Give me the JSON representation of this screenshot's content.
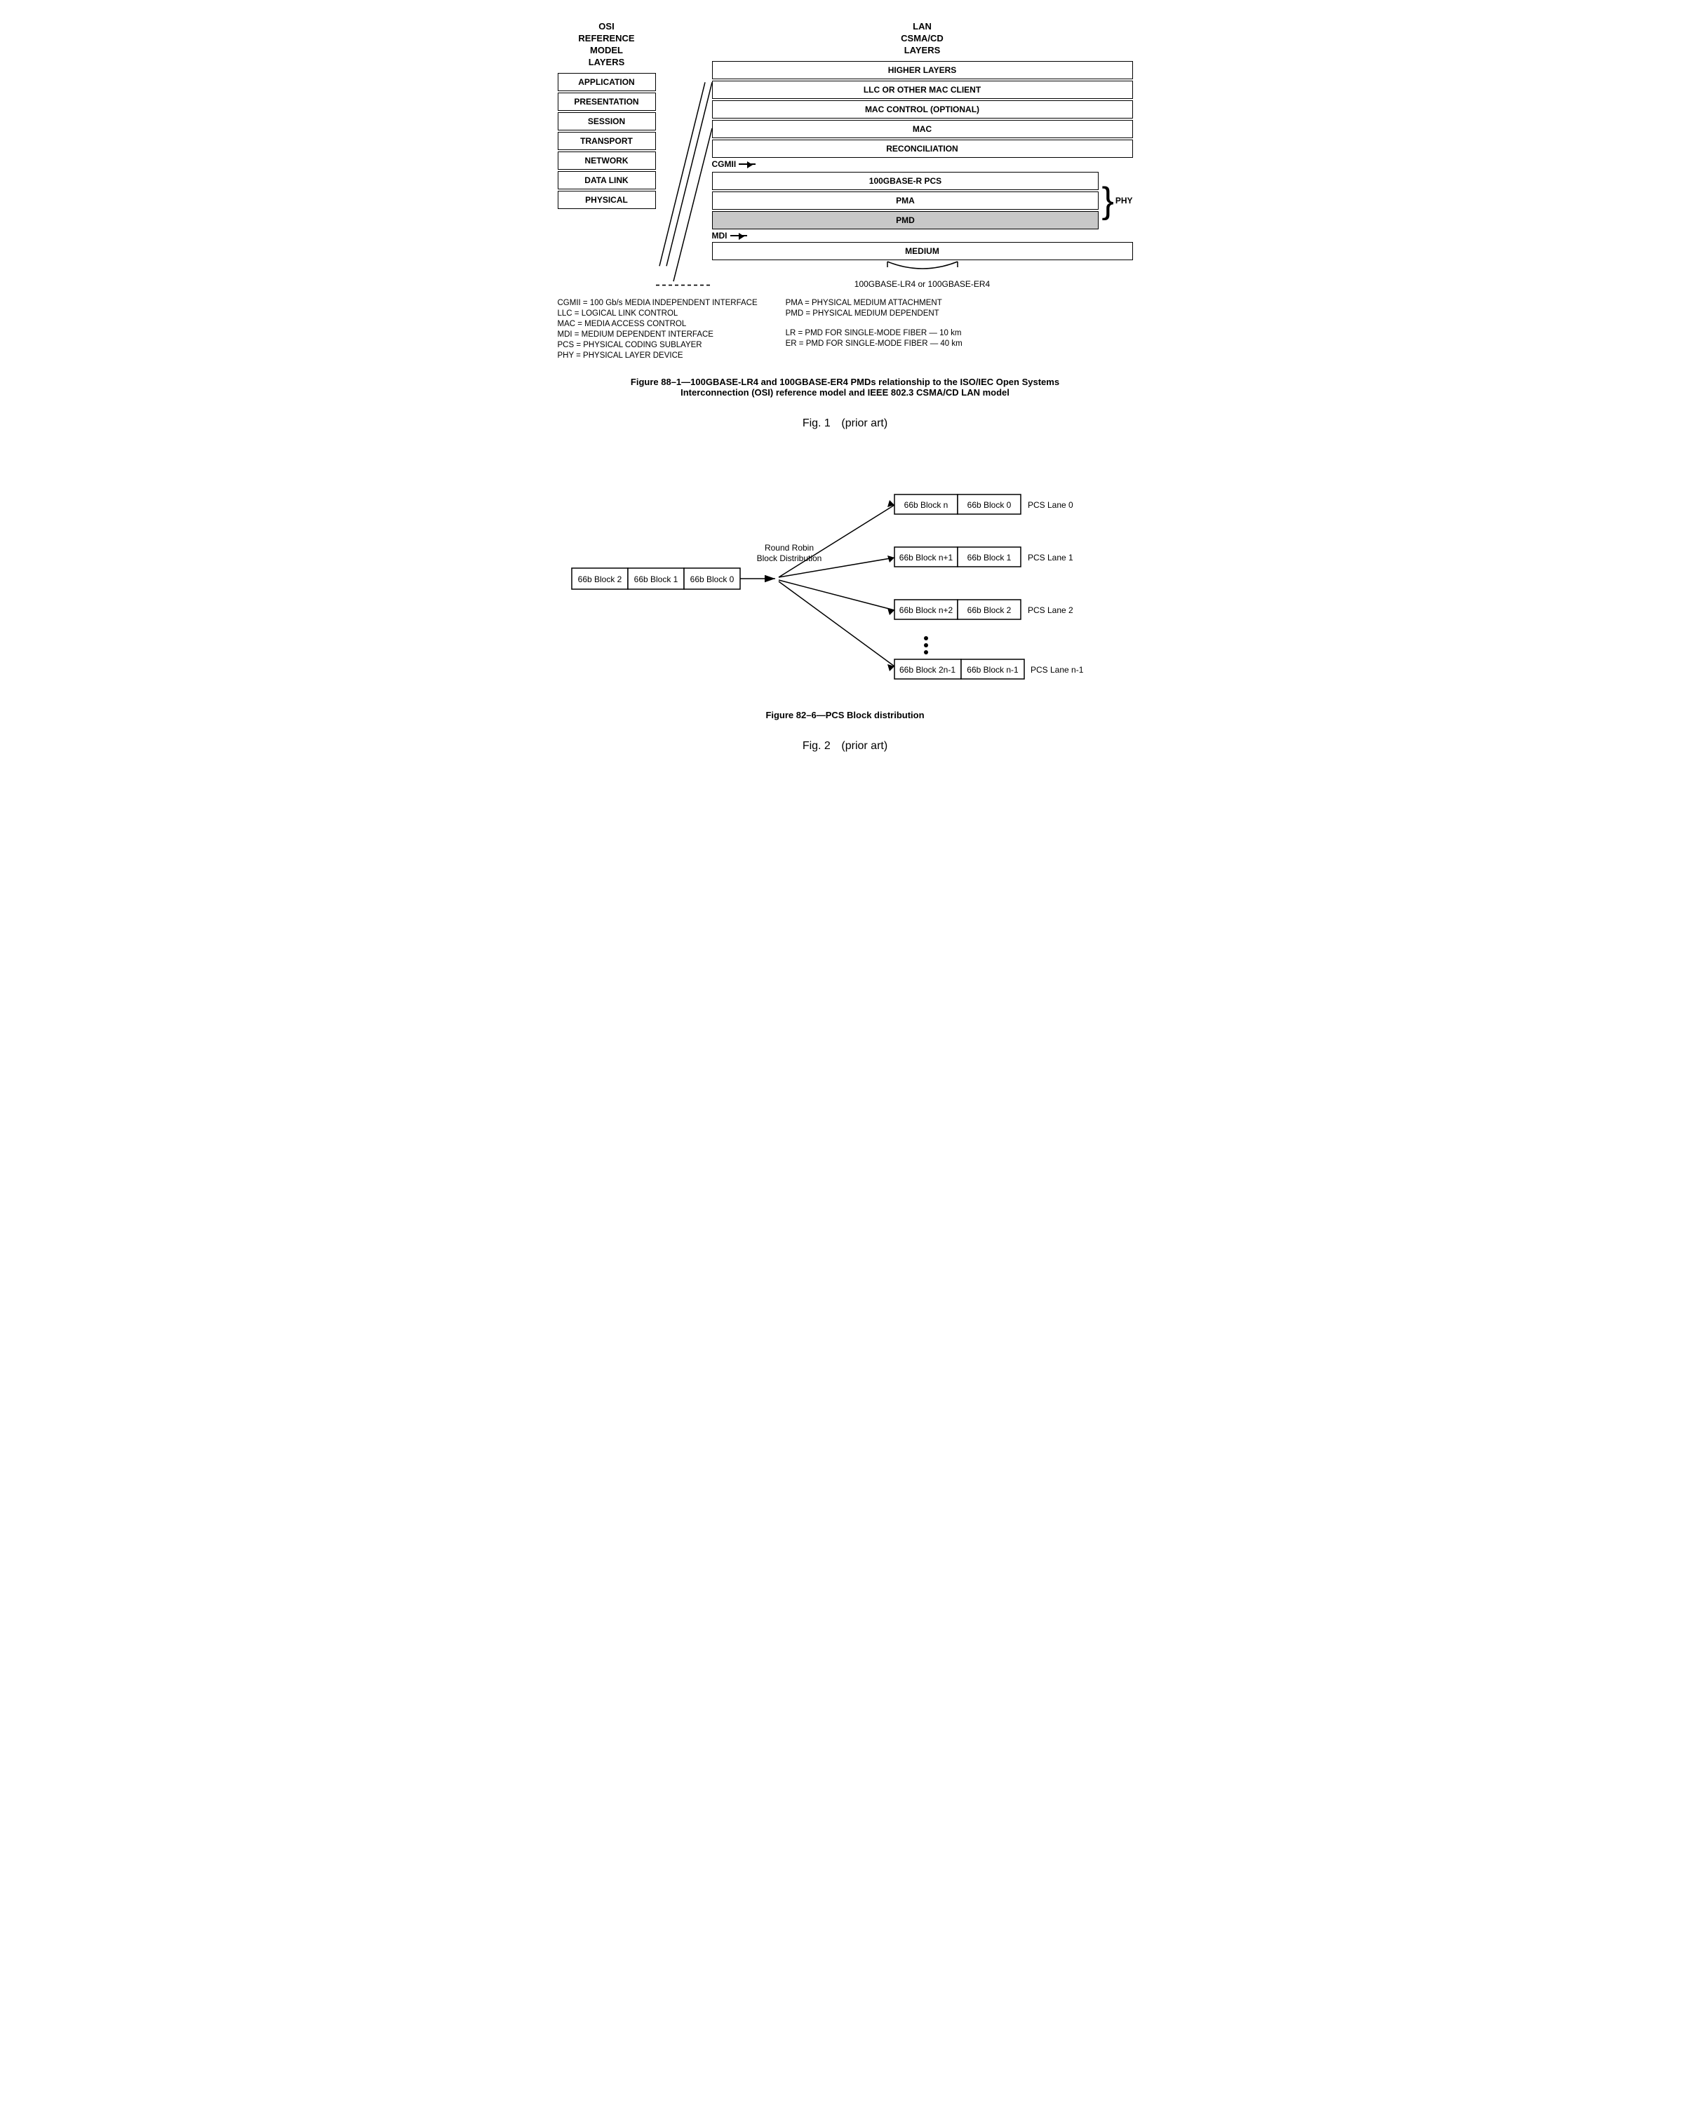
{
  "fig1": {
    "osi": {
      "header": "OSI\nREFERENCE\nMODEL\nLAYERS",
      "layers": [
        "APPLICATION",
        "PRESENTATION",
        "SESSION",
        "TRANSPORT",
        "NETWORK",
        "DATA LINK",
        "PHYSICAL"
      ]
    },
    "lan": {
      "header": "LAN\nCSMA/CD\nLAYERS",
      "layers": [
        {
          "label": "HIGHER LAYERS",
          "shaded": false
        },
        {
          "label": "LLC OR OTHER MAC CLIENT",
          "shaded": false
        },
        {
          "label": "MAC CONTROL (OPTIONAL)",
          "shaded": false
        },
        {
          "label": "MAC",
          "shaded": false
        },
        {
          "label": "RECONCILIATION",
          "shaded": false
        }
      ],
      "cgmii": "CGMII",
      "pcs": "100GBASE-R PCS",
      "pma": "PMA",
      "pmd": "PMD",
      "phy_label": "PHY",
      "mdi": "MDI",
      "medium": "MEDIUM",
      "medium_sub": "100GBASE-LR4 or 100GBASE-ER4"
    },
    "abbrev": {
      "left": [
        "CGMII = 100 Gb/s MEDIA INDEPENDENT INTERFACE",
        "LLC = LOGICAL LINK CONTROL",
        "MAC = MEDIA ACCESS CONTROL",
        "MDI = MEDIUM DEPENDENT INTERFACE",
        "PCS = PHYSICAL CODING SUBLAYER",
        "PHY = PHYSICAL LAYER DEVICE"
      ],
      "right": [
        "PMA = PHYSICAL MEDIUM ATTACHMENT",
        "PMD = PHYSICAL MEDIUM DEPENDENT",
        "",
        "LR = PMD FOR SINGLE-MODE FIBER — 10 km",
        "ER = PMD FOR SINGLE-MODE FIBER — 40 km"
      ]
    },
    "caption": "Figure 88–1—100GBASE-LR4 and 100GBASE-ER4 PMDs relationship to the ISO/IEC Open Systems Interconnection (OSI) reference model and IEEE 802.3 CSMA/CD LAN model",
    "fig_title": "Fig. 1",
    "fig_subtitle": "(prior art)"
  },
  "fig2": {
    "left_blocks": [
      "66b Block 2",
      "66b Block 1",
      "66b Block 0"
    ],
    "rr_label": "Round Robin\nBlock Distribution",
    "right_rows": [
      {
        "blocks": [
          "66b Block n",
          "66b Block 0"
        ],
        "lane": "PCS Lane 0"
      },
      {
        "blocks": [
          "66b Block n+1",
          "66b Block 1"
        ],
        "lane": "PCS Lane 1"
      },
      {
        "blocks": [
          "66b Block n+2",
          "66b Block 2"
        ],
        "lane": "PCS Lane 2"
      },
      {
        "blocks": [
          "66b Block 2n-1",
          "66b Block n-1"
        ],
        "lane": "PCS Lane n-1"
      }
    ],
    "caption": "Figure 82–6—PCS Block distribution",
    "fig_title": "Fig. 2",
    "fig_subtitle": "(prior art)"
  }
}
